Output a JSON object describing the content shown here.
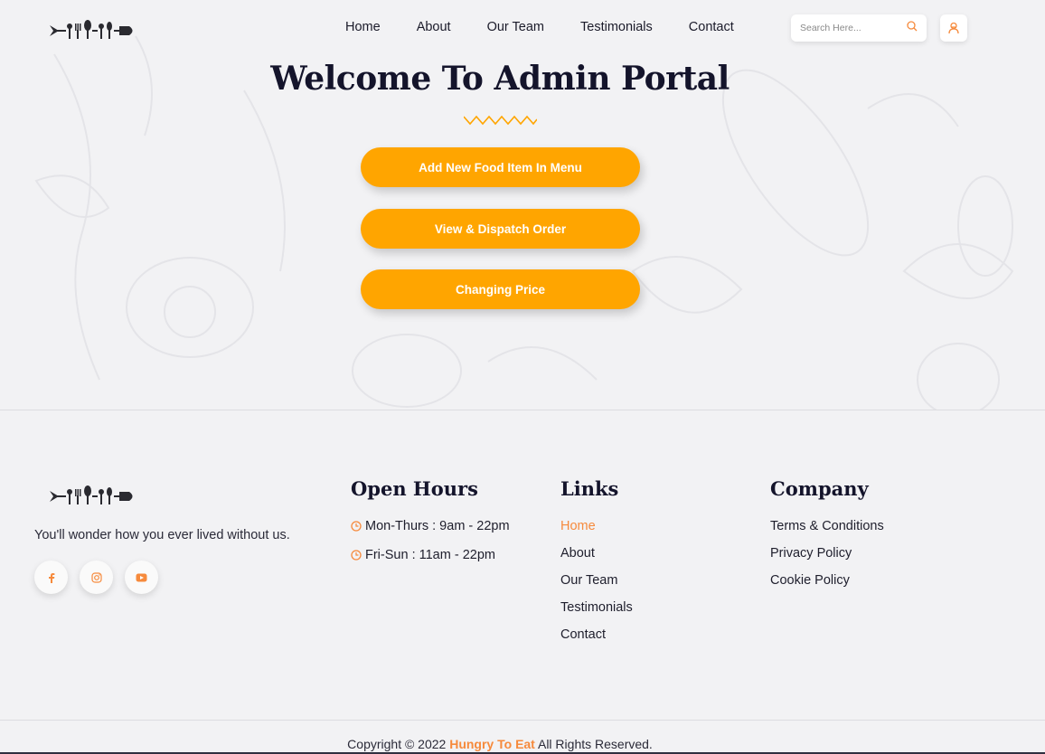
{
  "nav": {
    "items": [
      "Home",
      "About",
      "Our Team",
      "Testimonials",
      "Contact"
    ],
    "search_placeholder": "Search Here...",
    "search_icon": "search-icon",
    "user_icon": "user-icon"
  },
  "main": {
    "title": "Welcome To Admin Portal",
    "buttons": [
      "Add New Food Item In Menu",
      "View & Dispatch Order",
      "Changing Price"
    ]
  },
  "footer": {
    "tagline": "You'll wonder how you ever lived without us.",
    "social": [
      "facebook-icon",
      "instagram-icon",
      "youtube-icon"
    ],
    "open_hours": {
      "title": "Open Hours",
      "items": [
        "Mon-Thurs : 9am - 22pm",
        "Fri-Sun : 11am - 22pm"
      ]
    },
    "links": {
      "title": "Links",
      "items": [
        "Home",
        "About",
        "Our Team",
        "Testimonials",
        "Contact"
      ]
    },
    "company": {
      "title": "Company",
      "items": [
        "Terms & Conditions",
        "Privacy Policy",
        "Cookie Policy"
      ]
    },
    "copyright_prefix": "Copyright © 2022",
    "brand": "Hungry To Eat",
    "copyright_suffix": "All Rights Reserved."
  },
  "colors": {
    "accent": "#ffa500",
    "link_active": "#f68a3c",
    "background": "#f2f2f4",
    "heading": "#14142b"
  }
}
